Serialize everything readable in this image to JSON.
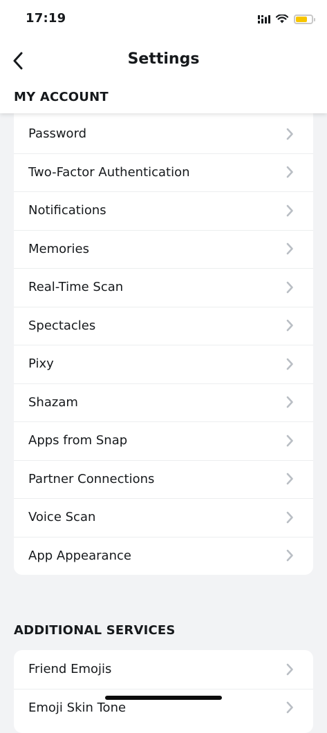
{
  "status_bar": {
    "time": "17:19",
    "icons": [
      "signal-icon",
      "wifi-icon",
      "battery-icon"
    ],
    "battery_color": "#f7c500"
  },
  "nav": {
    "back_icon": "chevron-left-icon",
    "title": "Settings"
  },
  "sections": {
    "my_account": {
      "title": "MY ACCOUNT",
      "items": [
        {
          "label": "Password"
        },
        {
          "label": "Two-Factor Authentication"
        },
        {
          "label": "Notifications"
        },
        {
          "label": "Memories"
        },
        {
          "label": "Real-Time Scan"
        },
        {
          "label": "Spectacles"
        },
        {
          "label": "Pixy"
        },
        {
          "label": "Shazam"
        },
        {
          "label": "Apps from Snap"
        },
        {
          "label": "Partner Connections"
        },
        {
          "label": "Voice Scan"
        },
        {
          "label": "App Appearance"
        }
      ]
    },
    "additional_services": {
      "title": "ADDITIONAL SERVICES",
      "items": [
        {
          "label": "Friend Emojis"
        },
        {
          "label": "Emoji Skin Tone"
        }
      ]
    }
  },
  "colors": {
    "background": "#f2f3f5",
    "card": "#ffffff",
    "text": "#16191c",
    "chevron": "#b9bec4"
  }
}
